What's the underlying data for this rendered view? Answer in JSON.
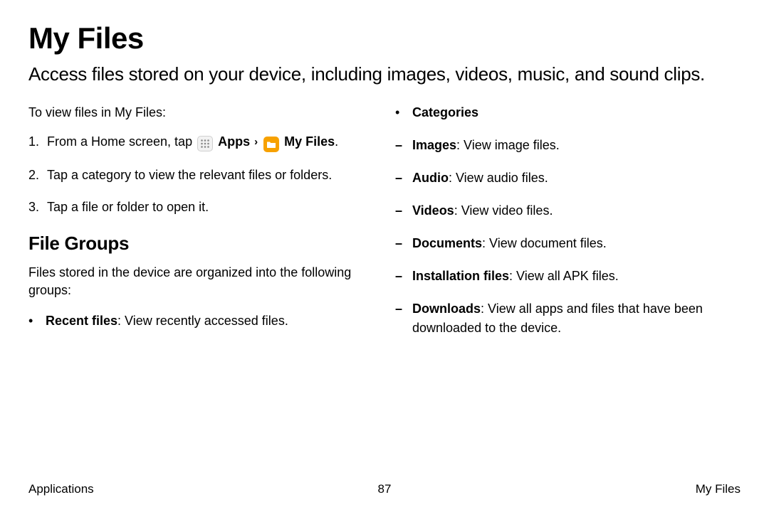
{
  "title": "My Files",
  "subtitle": "Access files stored on your device, including images, videos, music, and sound clips.",
  "lead": "To view files in My Files:",
  "steps": {
    "s1_pre": "From a Home screen, tap ",
    "s1_apps": "Apps",
    "s1_myfiles": "My Files",
    "s2": "Tap a category to view the relevant files or folders.",
    "s3": "Tap a file or folder to open it."
  },
  "fileGroups": {
    "heading": "File Groups",
    "desc": "Files stored in the device are organized into the following groups:",
    "recent_bold": "Recent files",
    "recent_rest": ": View recently accessed files."
  },
  "categories": {
    "heading": "Categories",
    "items": [
      {
        "bold": "Images",
        "rest": ": View image files."
      },
      {
        "bold": "Audio",
        "rest": ": View audio files."
      },
      {
        "bold": "Videos",
        "rest": ": View video files."
      },
      {
        "bold": "Documents",
        "rest": ": View document files."
      },
      {
        "bold": "Installation files",
        "rest": ": View all APK files."
      },
      {
        "bold": "Downloads",
        "rest": ": View all apps and files that have been downloaded to the device."
      }
    ]
  },
  "footer": {
    "left": "Applications",
    "center": "87",
    "right": "My Files"
  }
}
